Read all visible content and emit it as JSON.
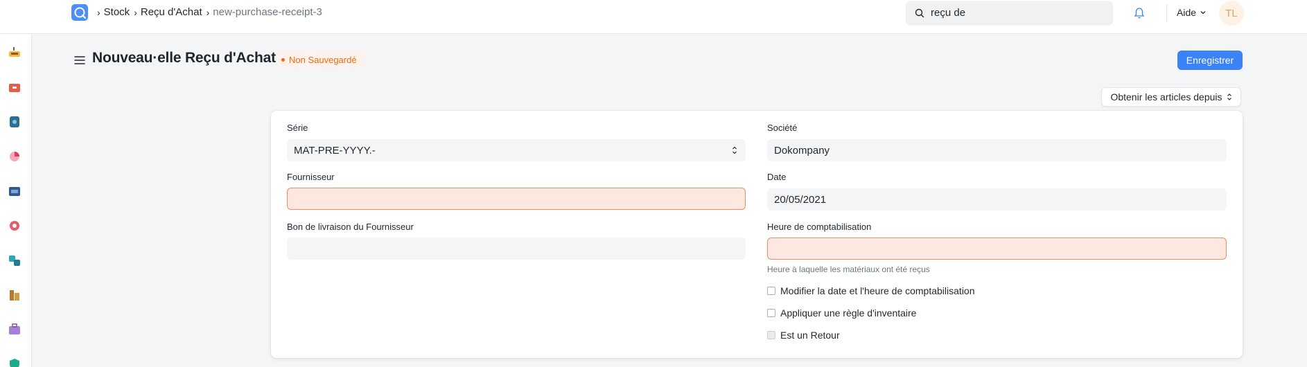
{
  "breadcrumb": {
    "items": [
      "Stock",
      "Reçu d'Achat"
    ],
    "current": "new-purchase-receipt-3"
  },
  "search": {
    "value": "reçu de"
  },
  "header": {
    "help_label": "Aide",
    "avatar_initials": "TL"
  },
  "sidebar": {
    "icons": [
      "inbox-tray-icon",
      "toolbox-icon",
      "box-icon",
      "pie-chart-icon",
      "folder-icon",
      "support-icon",
      "cubes-icon",
      "building-icon",
      "briefcase-icon",
      "shield-icon"
    ]
  },
  "page": {
    "title": "Nouveau·elle Reçu d'Achat",
    "status": "Non Sauvegardé",
    "save_label": "Enregistrer",
    "get_items_label": "Obtenir les articles depuis"
  },
  "form": {
    "serie_label": "Série",
    "serie_value": "MAT-PRE-YYYY.-",
    "supplier_label": "Fournisseur",
    "supplier_value": "",
    "supplier_delivery_label": "Bon de livraison du Fournisseur",
    "supplier_delivery_value": "",
    "company_label": "Société",
    "company_value": "Dokompany",
    "date_label": "Date",
    "date_value": "20/05/2021",
    "posting_time_label": "Heure de comptabilisation",
    "posting_time_value": "",
    "posting_time_help": "Heure à laquelle les matériaux ont été reçus",
    "checkboxes": [
      "Modifier la date et l'heure de comptabilisation",
      "Appliquer une règle d'inventaire",
      "Est un Retour"
    ]
  },
  "colors": {
    "primary": "#3b82f6",
    "error_bg": "#fde8df",
    "error_border": "#f28a66",
    "status": "#e86c13"
  }
}
